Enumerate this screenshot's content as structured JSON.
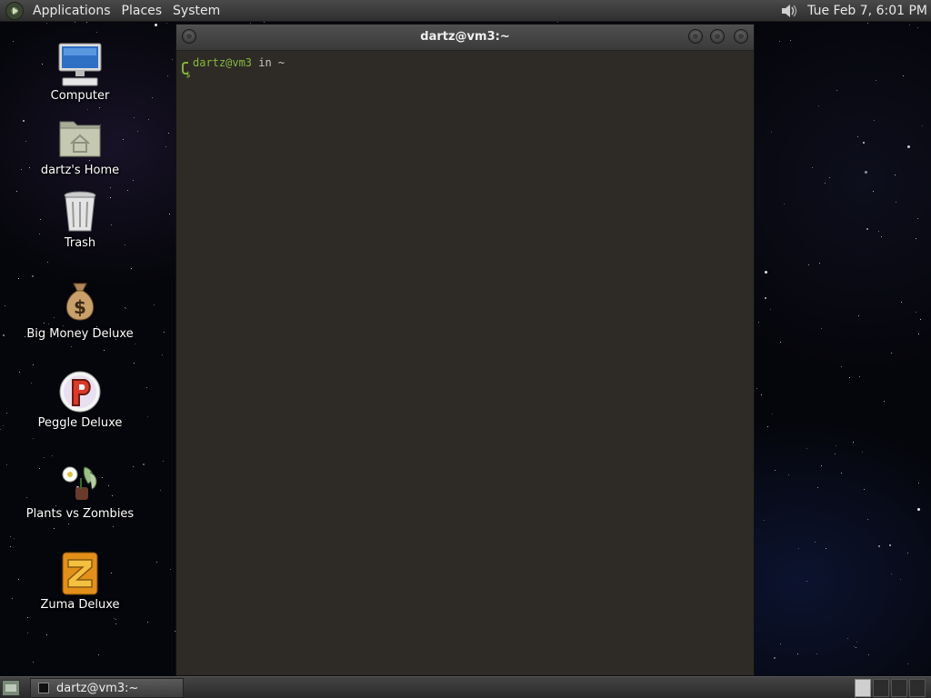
{
  "top_panel": {
    "menus": [
      "Applications",
      "Places",
      "System"
    ],
    "clock": "Tue Feb  7,  6:01 PM"
  },
  "desktop_icons": [
    {
      "label": "Computer",
      "icon": "computer-icon"
    },
    {
      "label": "dartz's Home",
      "icon": "home-folder-icon"
    },
    {
      "label": "Trash",
      "icon": "trash-icon"
    },
    {
      "label": "Big Money Deluxe",
      "icon": "money-bag-icon"
    },
    {
      "label": "Peggle Deluxe",
      "icon": "peggle-icon"
    },
    {
      "label": "Plants vs Zombies",
      "icon": "plants-vs-zombies-icon"
    },
    {
      "label": "Zuma Deluxe",
      "icon": "zuma-icon"
    }
  ],
  "terminal": {
    "title": "dartz@vm3:~",
    "prompt_user": "dartz@vm3",
    "prompt_rest": " in ~",
    "prompt_symbol": "$"
  },
  "bottom_panel": {
    "task_label": "dartz@vm3:~",
    "workspaces": 4,
    "active_workspace": 1
  }
}
